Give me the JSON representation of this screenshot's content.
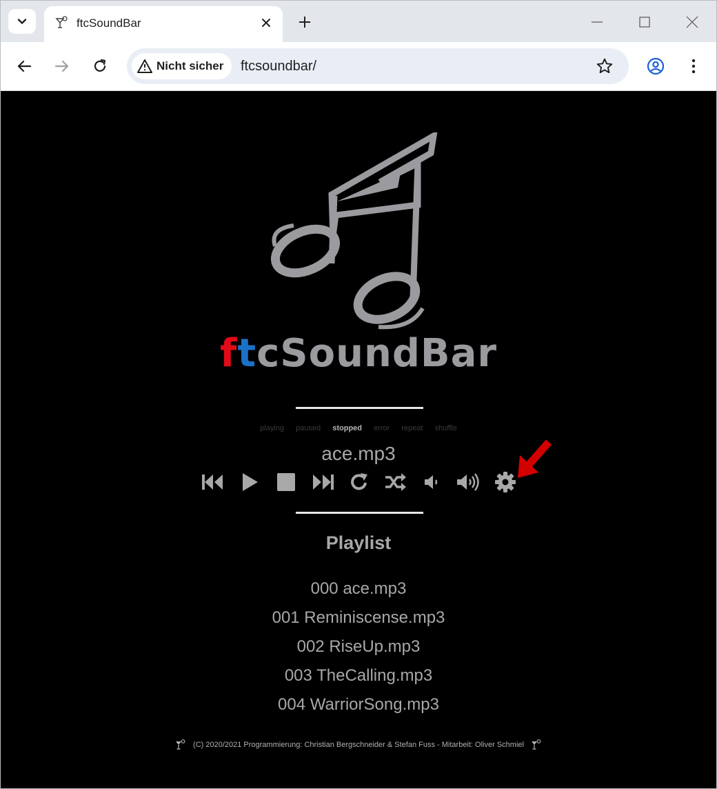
{
  "browser": {
    "tab_title": "ftcSoundBar",
    "security_label": "Nicht sicher",
    "url": "ftcsoundbar/"
  },
  "icons": {
    "tab_search": "chevron-down-icon",
    "favicon": "cocktail-favicon-icon",
    "tab_close": "close-icon",
    "new_tab": "plus-icon",
    "back": "arrow-left-icon",
    "forward": "arrow-right-icon",
    "reload": "reload-icon",
    "warning": "warning-triangle-icon",
    "bookmark": "star-icon",
    "profile": "profile-icon",
    "menu": "kebab-menu-icon"
  },
  "app": {
    "brand_f": "f",
    "brand_t": "t",
    "brand_rest": "cSoundBar",
    "status_flags": [
      {
        "label": "playing",
        "active": false
      },
      {
        "label": "paused",
        "active": false
      },
      {
        "label": "stopped",
        "active": true
      },
      {
        "label": "error",
        "active": false
      },
      {
        "label": "repeat",
        "active": false
      },
      {
        "label": "shuffle",
        "active": false
      }
    ],
    "current_track": "ace.mp3",
    "controls": [
      "previous",
      "play",
      "stop",
      "next",
      "repeat",
      "shuffle",
      "volume-down",
      "volume-up",
      "settings"
    ],
    "playlist_title": "Playlist",
    "playlist": [
      "000 ace.mp3",
      "001 Reminiscense.mp3",
      "002 RiseUp.mp3",
      "003 TheCalling.mp3",
      "004 WarriorSong.mp3"
    ],
    "footer": "(C) 2020/2021 Programmierung: Christian Bergschneider & Stefan Fuss - Mitarbeit: Oliver Schmiel"
  },
  "colors": {
    "brand_red": "#e10b17",
    "brand_blue": "#1a72c8",
    "logo_grey": "#9b9b9f",
    "annotation_arrow": "#d40000"
  }
}
